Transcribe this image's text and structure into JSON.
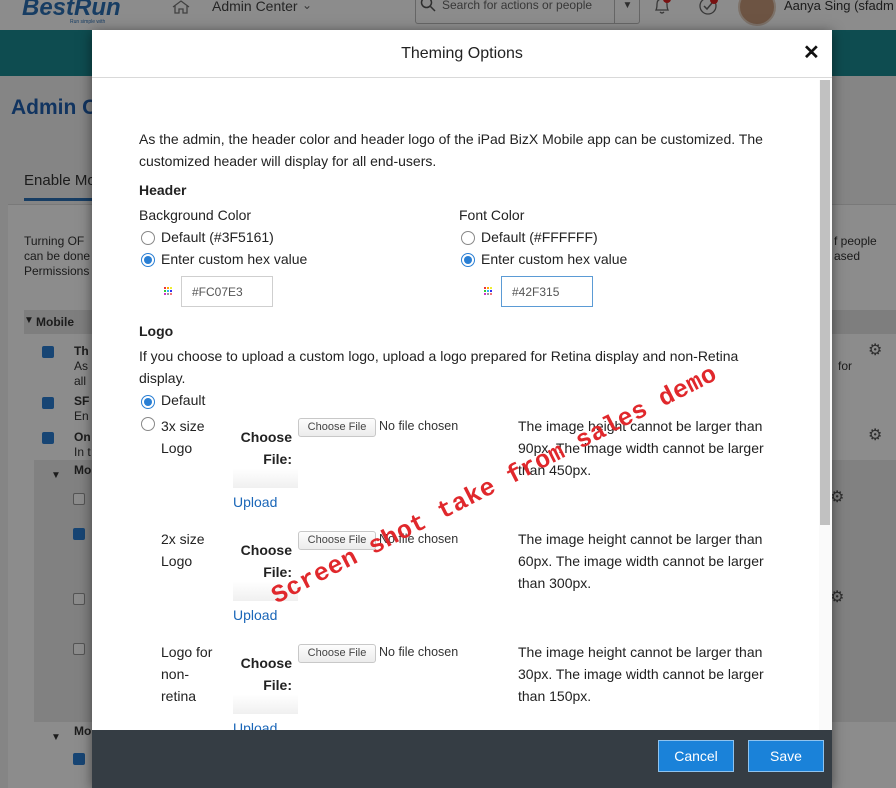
{
  "app": {
    "logo": "BestRun",
    "logo_tagline": "Run simple with",
    "nav_label": "Admin Center",
    "search_placeholder": "Search for actions or people",
    "user_name": "Aanya Sing (sfadm",
    "page_title": "Admin C",
    "tab_label": "Enable Mo",
    "left_text": "Turning OF can be done Permissions",
    "right_text": "f people ased",
    "mobile_section": "Mobile",
    "row_items": [
      {
        "bold": "Th",
        "text1": "As",
        "text2": "all"
      },
      {
        "bold": "SF",
        "text1": "En"
      },
      {
        "bold": "On",
        "text1": "In t"
      }
    ],
    "sub_label": "Mo",
    "right_for": "for",
    "mo_bottom": "Mo"
  },
  "dialog": {
    "title": "Theming Options",
    "intro": "As the admin, the header color and header logo of the iPad BizX Mobile app can be customized. The customized header will display for all end-users.",
    "header_section": "Header",
    "background_color": {
      "label": "Background Color",
      "default_option": "Default (#3F5161)",
      "custom_option": "Enter custom hex value",
      "value": "#FC07E3",
      "selected": "custom"
    },
    "font_color": {
      "label": "Font Color",
      "default_option": "Default (#FFFFFF)",
      "custom_option": "Enter custom hex value",
      "value": "#42F315",
      "selected": "custom"
    },
    "logo_section": "Logo",
    "logo_intro": "If you choose to upload a custom logo, upload a logo prepared for Retina display and non-Retina display.",
    "logo_default_option": "Default",
    "logo_rows": [
      {
        "name": "3x size Logo",
        "choose_label": "Choose File:",
        "button": "Choose File",
        "status": "No file chosen",
        "hint": "The image height cannot be larger than 90px. The image width cannot be larger than 450px.",
        "upload": "Upload"
      },
      {
        "name": "2x size Logo",
        "choose_label": "Choose File:",
        "button": "Choose File",
        "status": "No file chosen",
        "hint": "The image height cannot be larger than 60px. The image width cannot be larger than 300px.",
        "upload": "Upload"
      },
      {
        "name": "Logo for non-retina",
        "choose_label": "Choose File:",
        "button": "Choose File",
        "status": "No file chosen",
        "hint": "The image height cannot be larger than 30px. The image width cannot be larger than 150px.",
        "upload": "Upload"
      }
    ],
    "watermark": "Screen shot take from sales demo",
    "cancel_label": "Cancel",
    "save_label": "Save"
  },
  "colors": {
    "primary": "#1a82d9",
    "footer": "#353d44",
    "teal": "#1a8a92",
    "link": "#1a66b8",
    "watermark": "#e0282c"
  }
}
